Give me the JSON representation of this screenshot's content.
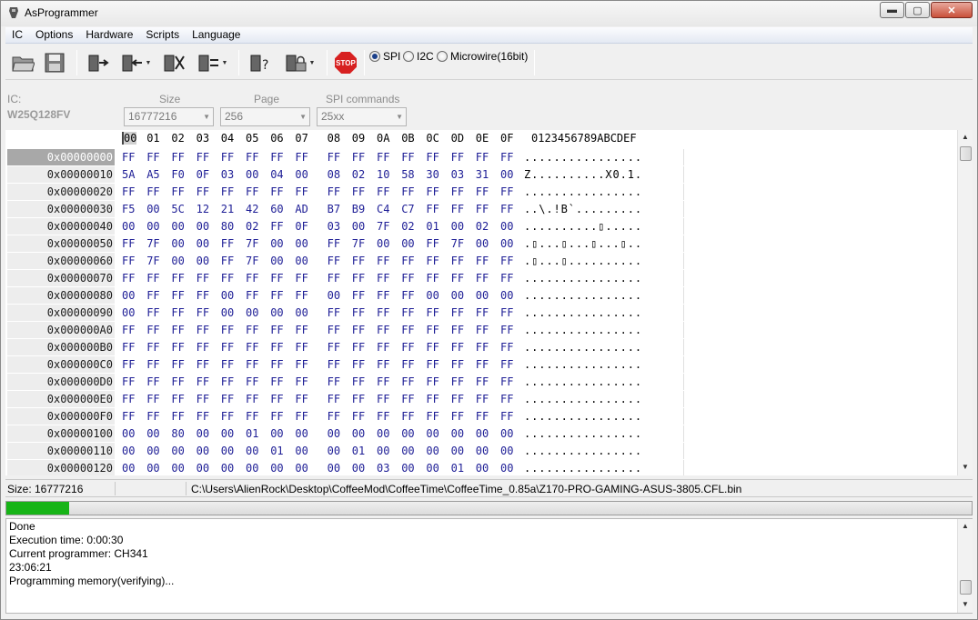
{
  "window": {
    "title": "AsProgrammer",
    "min_glyph": "▬",
    "max_glyph": "▢",
    "close_glyph": "✕"
  },
  "menu": [
    "IC",
    "Options",
    "Hardware",
    "Scripts",
    "Language"
  ],
  "toolbar": {
    "icons": [
      "open-file-icon",
      "save-file-icon",
      "read-chip-icon",
      "write-chip-icon",
      "erase-chip-icon",
      "verify-chip-icon",
      "blank-check-icon",
      "lock-chip-icon",
      "stop-icon"
    ],
    "stop_label": "STOP",
    "protocols": [
      {
        "label": "SPI",
        "selected": true
      },
      {
        "label": "I2C",
        "selected": false
      },
      {
        "label": "Microwire(16bit)",
        "selected": false
      }
    ]
  },
  "ic_panel": {
    "ic_label": "IC:",
    "ic_name": "W25Q128FV",
    "size_label": "Size",
    "size_value": "16777216",
    "page_label": "Page",
    "page_value": "256",
    "spi_label": "SPI commands",
    "spi_value": "25xx"
  },
  "hex": {
    "columns": [
      "00",
      "01",
      "02",
      "03",
      "04",
      "05",
      "06",
      "07",
      "08",
      "09",
      "0A",
      "0B",
      "0C",
      "0D",
      "0E",
      "0F"
    ],
    "ascii_header": "0123456789ABCDEF",
    "rows": [
      {
        "addr": "0x00000000",
        "bytes": [
          "FF",
          "FF",
          "FF",
          "FF",
          "FF",
          "FF",
          "FF",
          "FF",
          "FF",
          "FF",
          "FF",
          "FF",
          "FF",
          "FF",
          "FF",
          "FF"
        ],
        "ascii": "................"
      },
      {
        "addr": "0x00000010",
        "bytes": [
          "5A",
          "A5",
          "F0",
          "0F",
          "03",
          "00",
          "04",
          "00",
          "08",
          "02",
          "10",
          "58",
          "30",
          "03",
          "31",
          "00"
        ],
        "ascii": "Z..........X0.1."
      },
      {
        "addr": "0x00000020",
        "bytes": [
          "FF",
          "FF",
          "FF",
          "FF",
          "FF",
          "FF",
          "FF",
          "FF",
          "FF",
          "FF",
          "FF",
          "FF",
          "FF",
          "FF",
          "FF",
          "FF"
        ],
        "ascii": "................"
      },
      {
        "addr": "0x00000030",
        "bytes": [
          "F5",
          "00",
          "5C",
          "12",
          "21",
          "42",
          "60",
          "AD",
          "B7",
          "B9",
          "C4",
          "C7",
          "FF",
          "FF",
          "FF",
          "FF"
        ],
        "ascii": "..\\.!B`........."
      },
      {
        "addr": "0x00000040",
        "bytes": [
          "00",
          "00",
          "00",
          "00",
          "80",
          "02",
          "FF",
          "0F",
          "03",
          "00",
          "7F",
          "02",
          "01",
          "00",
          "02",
          "00"
        ],
        "ascii": "..........▯....."
      },
      {
        "addr": "0x00000050",
        "bytes": [
          "FF",
          "7F",
          "00",
          "00",
          "FF",
          "7F",
          "00",
          "00",
          "FF",
          "7F",
          "00",
          "00",
          "FF",
          "7F",
          "00",
          "00"
        ],
        "ascii": ".▯...▯...▯...▯.."
      },
      {
        "addr": "0x00000060",
        "bytes": [
          "FF",
          "7F",
          "00",
          "00",
          "FF",
          "7F",
          "00",
          "00",
          "FF",
          "FF",
          "FF",
          "FF",
          "FF",
          "FF",
          "FF",
          "FF"
        ],
        "ascii": ".▯...▯.........."
      },
      {
        "addr": "0x00000070",
        "bytes": [
          "FF",
          "FF",
          "FF",
          "FF",
          "FF",
          "FF",
          "FF",
          "FF",
          "FF",
          "FF",
          "FF",
          "FF",
          "FF",
          "FF",
          "FF",
          "FF"
        ],
        "ascii": "................"
      },
      {
        "addr": "0x00000080",
        "bytes": [
          "00",
          "FF",
          "FF",
          "FF",
          "00",
          "FF",
          "FF",
          "FF",
          "00",
          "FF",
          "FF",
          "FF",
          "00",
          "00",
          "00",
          "00"
        ],
        "ascii": "................"
      },
      {
        "addr": "0x00000090",
        "bytes": [
          "00",
          "FF",
          "FF",
          "FF",
          "00",
          "00",
          "00",
          "00",
          "FF",
          "FF",
          "FF",
          "FF",
          "FF",
          "FF",
          "FF",
          "FF"
        ],
        "ascii": "................"
      },
      {
        "addr": "0x000000A0",
        "bytes": [
          "FF",
          "FF",
          "FF",
          "FF",
          "FF",
          "FF",
          "FF",
          "FF",
          "FF",
          "FF",
          "FF",
          "FF",
          "FF",
          "FF",
          "FF",
          "FF"
        ],
        "ascii": "................"
      },
      {
        "addr": "0x000000B0",
        "bytes": [
          "FF",
          "FF",
          "FF",
          "FF",
          "FF",
          "FF",
          "FF",
          "FF",
          "FF",
          "FF",
          "FF",
          "FF",
          "FF",
          "FF",
          "FF",
          "FF"
        ],
        "ascii": "................"
      },
      {
        "addr": "0x000000C0",
        "bytes": [
          "FF",
          "FF",
          "FF",
          "FF",
          "FF",
          "FF",
          "FF",
          "FF",
          "FF",
          "FF",
          "FF",
          "FF",
          "FF",
          "FF",
          "FF",
          "FF"
        ],
        "ascii": "................"
      },
      {
        "addr": "0x000000D0",
        "bytes": [
          "FF",
          "FF",
          "FF",
          "FF",
          "FF",
          "FF",
          "FF",
          "FF",
          "FF",
          "FF",
          "FF",
          "FF",
          "FF",
          "FF",
          "FF",
          "FF"
        ],
        "ascii": "................"
      },
      {
        "addr": "0x000000E0",
        "bytes": [
          "FF",
          "FF",
          "FF",
          "FF",
          "FF",
          "FF",
          "FF",
          "FF",
          "FF",
          "FF",
          "FF",
          "FF",
          "FF",
          "FF",
          "FF",
          "FF"
        ],
        "ascii": "................"
      },
      {
        "addr": "0x000000F0",
        "bytes": [
          "FF",
          "FF",
          "FF",
          "FF",
          "FF",
          "FF",
          "FF",
          "FF",
          "FF",
          "FF",
          "FF",
          "FF",
          "FF",
          "FF",
          "FF",
          "FF"
        ],
        "ascii": "................"
      },
      {
        "addr": "0x00000100",
        "bytes": [
          "00",
          "00",
          "80",
          "00",
          "00",
          "01",
          "00",
          "00",
          "00",
          "00",
          "00",
          "00",
          "00",
          "00",
          "00",
          "00"
        ],
        "ascii": "................"
      },
      {
        "addr": "0x00000110",
        "bytes": [
          "00",
          "00",
          "00",
          "00",
          "00",
          "00",
          "01",
          "00",
          "00",
          "01",
          "00",
          "00",
          "00",
          "00",
          "00",
          "00"
        ],
        "ascii": "................"
      },
      {
        "addr": "0x00000120",
        "bytes": [
          "00",
          "00",
          "00",
          "00",
          "00",
          "00",
          "00",
          "00",
          "00",
          "00",
          "03",
          "00",
          "00",
          "01",
          "00",
          "00"
        ],
        "ascii": "................"
      }
    ]
  },
  "status": {
    "size_text": "Size: 16777216",
    "path": "C:\\Users\\AlienRock\\Desktop\\CoffeeMod\\CoffeeTime\\CoffeeTime_0.85a\\Z170-PRO-GAMING-ASUS-3805.CFL.bin"
  },
  "progress": {
    "fraction": 0.065,
    "color": "#17b417"
  },
  "log": [
    "Done",
    "Execution time: 0:00:30",
    "Current programmer: CH341",
    "23:06:21",
    "Programming memory(verifying)..."
  ],
  "scroll": {
    "up": "▲",
    "down": "▼"
  }
}
